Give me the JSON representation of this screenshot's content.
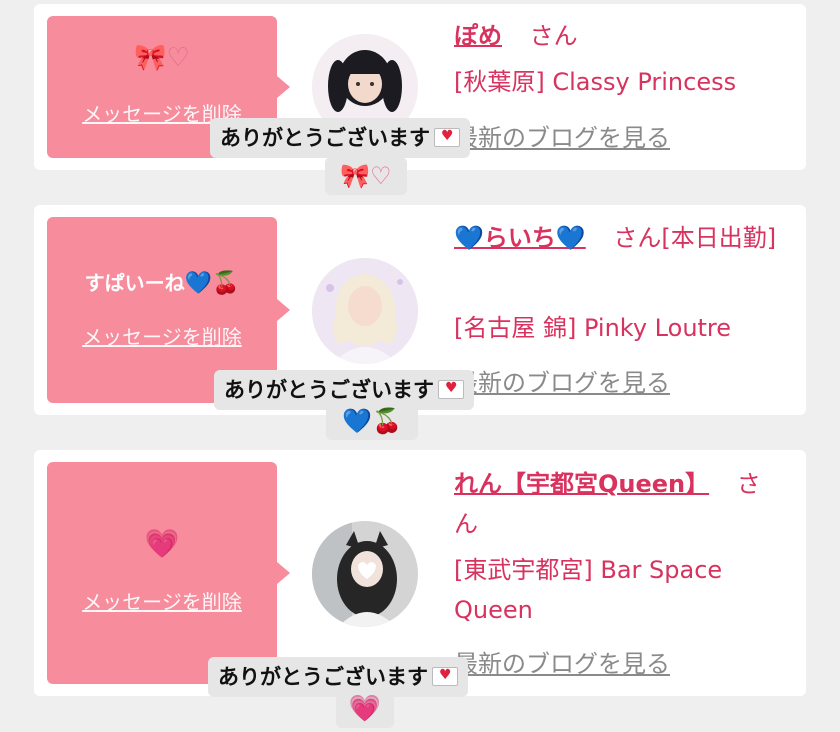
{
  "colors": {
    "bubble": "#f68c9c",
    "name": "#d8325f",
    "link_gray": "#8a8a8a",
    "background": "#efefef"
  },
  "messages": [
    {
      "message_text": "",
      "message_emoji": "🎀♡",
      "delete_label": "メッセージを削除",
      "name": "ぽめ",
      "honorific": "さん",
      "shop": "[秋葉原] Classy Princess",
      "blog_label": "最新のブログを見る",
      "reply_text": "ありがとうございます",
      "reply_emoji": "🎀♡",
      "reply_icon": "love-letter-icon"
    },
    {
      "message_text": "すぱいーね",
      "message_emoji": "💙🍒",
      "delete_label": "メッセージを削除",
      "name": "💙らいち💙",
      "honorific": "さん[本日出勤]",
      "shop": "[名古屋 錦] Pinky Loutre",
      "blog_label": "最新のブログを見る",
      "reply_text": "ありがとうございます",
      "reply_emoji": "💙🍒",
      "reply_icon": "love-letter-icon"
    },
    {
      "message_text": "",
      "message_emoji": "💗",
      "delete_label": "メッセージを削除",
      "name": "れん【宇都宮Queen】",
      "honorific": "さん",
      "shop": "[東武宇都宮] Bar Space Queen",
      "blog_label": "最新のブログを見る",
      "reply_text": "ありがとうございます",
      "reply_emoji": "💗",
      "reply_icon": "love-letter-icon"
    }
  ]
}
